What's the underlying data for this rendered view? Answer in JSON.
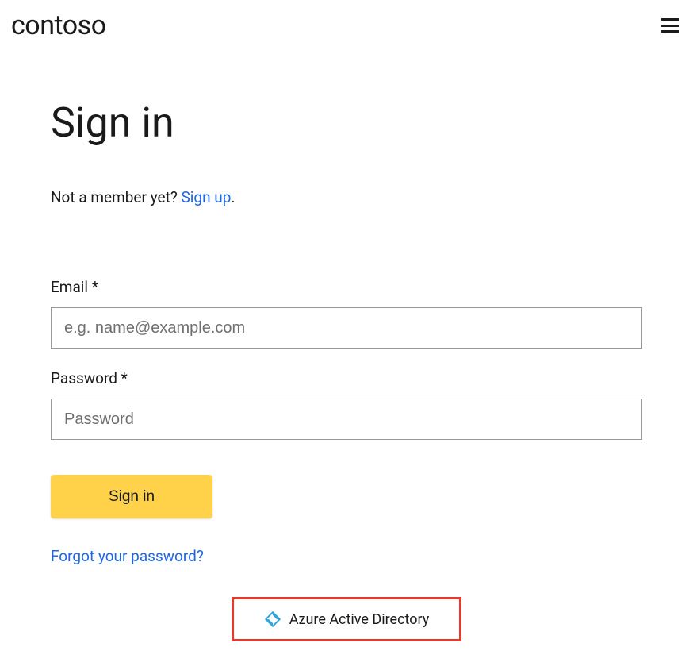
{
  "header": {
    "logo_text": "contoso"
  },
  "page": {
    "title": "Sign in",
    "signup_prompt_prefix": "Not a member yet? ",
    "signup_link_text": "Sign up",
    "signup_prompt_suffix": "."
  },
  "form": {
    "email": {
      "label": "Email *",
      "placeholder": "e.g. name@example.com",
      "value": ""
    },
    "password": {
      "label": "Password *",
      "placeholder": "Password",
      "value": ""
    },
    "submit_label": "Sign in",
    "forgot_link": "Forgot your password?"
  },
  "sso": {
    "aad_label": "Azure Active Directory"
  },
  "colors": {
    "primary_button": "#ffd24a",
    "link": "#1f66e5",
    "highlight_border": "#e23b2e",
    "aad_icon": "#2aa3dd"
  }
}
